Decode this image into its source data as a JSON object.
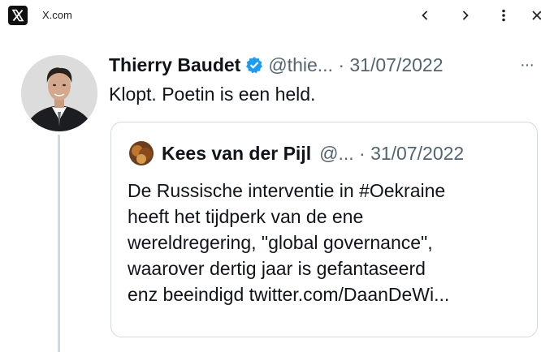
{
  "browser": {
    "site_title": "X.com",
    "site_icon": "x-logo-icon",
    "nav_icons": [
      "chevron-left-icon",
      "chevron-right-icon",
      "kebab-menu-icon",
      "close-icon"
    ]
  },
  "tweet": {
    "author_name": "Thierry Baudet",
    "handle": "@thie...",
    "separator": "·",
    "date": "31/07/2022",
    "more": "···",
    "text": "Klopt. Poetin is een held.",
    "verified_color": "#1d9bf0"
  },
  "quote": {
    "author_name": "Kees van der Pijl",
    "handle": "@...",
    "separator": "·",
    "date": "31/07/2022",
    "lines": [
      "De Russische interventie in #Oekraine",
      "heeft het tijdperk van de ene",
      "wereldregering, \"global governance\",",
      "waarover dertig jaar is gefantaseerd",
      "enz beeindigd twitter.com/DaanDeWi..."
    ]
  },
  "colors": {
    "text": "#0f1419",
    "secondary": "#536471",
    "border": "#cfd9de",
    "verified": "#1d9bf0"
  }
}
